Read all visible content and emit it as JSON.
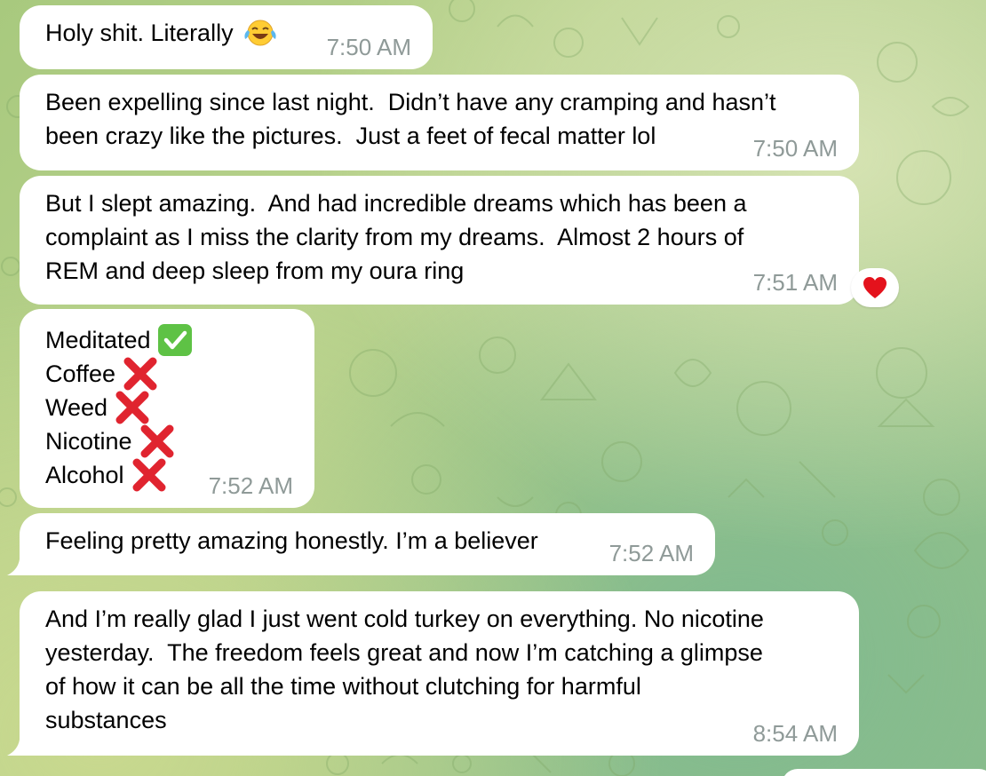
{
  "chat": {
    "messages": [
      {
        "text": "Holy shit. Literally",
        "time": "7:50 AM",
        "emoji": "laughing-crying-face"
      },
      {
        "text": "Been expelling since last night.  Didn’t have any cramping and hasn’t\nbeen crazy like the pictures.  Just a feet of fecal matter lol",
        "time": "7:50 AM"
      },
      {
        "text": "But I slept amazing.  And had incredible dreams which has been a\ncomplaint as I miss the clarity from my dreams.  Almost 2 hours of\nREM and deep sleep from my oura ring",
        "time": "7:51 AM",
        "reaction": "red-heart"
      },
      {
        "checklist": [
          {
            "label": "Meditated",
            "status": "check"
          },
          {
            "label": "Coffee",
            "status": "cross"
          },
          {
            "label": "Weed",
            "status": "cross"
          },
          {
            "label": "Nicotine",
            "status": "cross"
          },
          {
            "label": "Alcohol",
            "status": "cross"
          }
        ],
        "time": "7:52 AM"
      },
      {
        "text": "Feeling pretty amazing honestly. I’m a believer",
        "time": "7:52 AM"
      },
      {
        "text": "And I’m really glad I just went cold turkey on everything. No nicotine\nyesterday.  The freedom feels great and now I’m catching a glimpse\nof how it can be all the time without clutching for harmful\nsubstances",
        "time": "8:54 AM"
      }
    ]
  },
  "colors": {
    "bubble": "#ffffff",
    "time": "#8f9a98",
    "check_green": "#5ec245",
    "cross_red": "#e0242f",
    "heart_red": "#e4121c"
  }
}
